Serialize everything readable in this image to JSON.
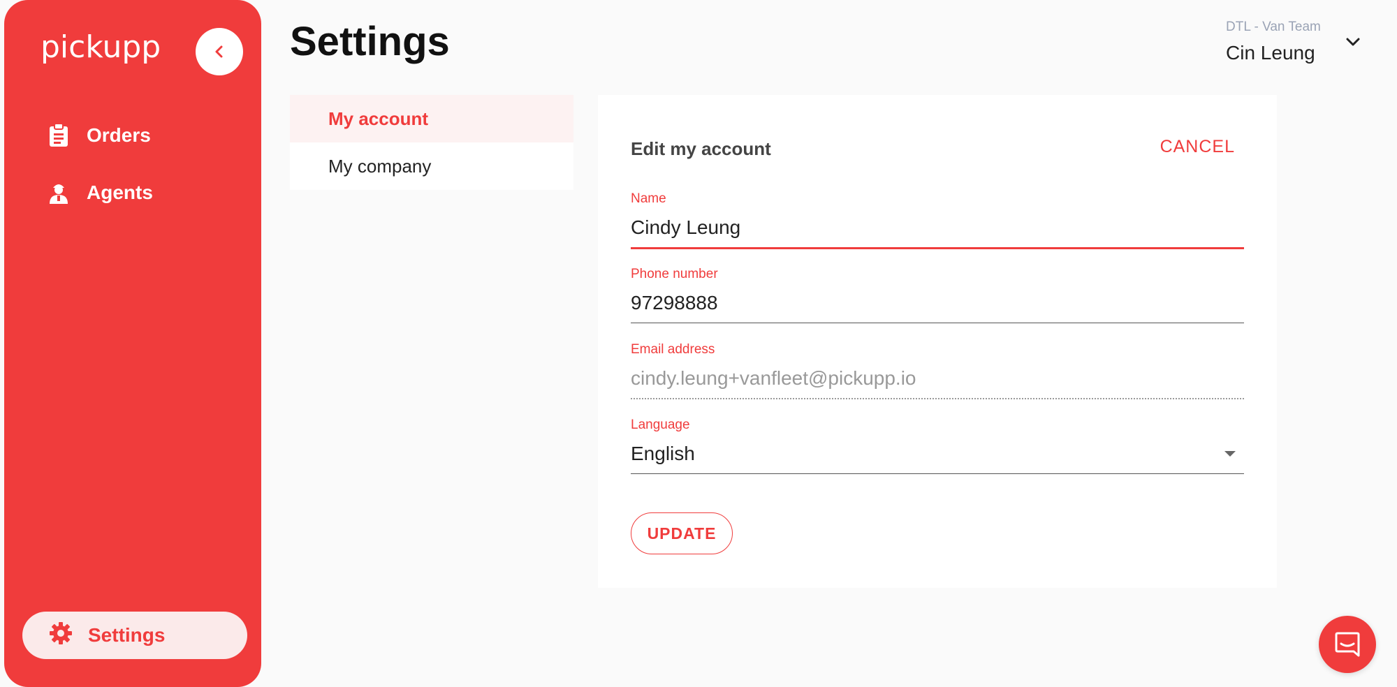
{
  "app": {
    "logo_text": "pickupp",
    "brand_color": "#f03c3c"
  },
  "sidebar": {
    "items": [
      {
        "label": "Orders",
        "icon": "clipboard-icon"
      },
      {
        "label": "Agents",
        "icon": "agent-icon"
      }
    ],
    "settings": {
      "label": "Settings",
      "icon": "gear-icon",
      "active": true
    }
  },
  "header": {
    "title": "Settings",
    "team": "DTL - Van Team",
    "user": "Cin Leung"
  },
  "submenu": {
    "items": [
      {
        "label": "My account",
        "active": true
      },
      {
        "label": "My company",
        "active": false
      }
    ]
  },
  "form": {
    "title": "Edit my account",
    "cancel_label": "CANCEL",
    "name": {
      "label": "Name",
      "value": "Cindy Leung"
    },
    "phone": {
      "label": "Phone number",
      "value": "97298888"
    },
    "email": {
      "label": "Email address",
      "value": "cindy.leung+vanfleet@pickupp.io"
    },
    "language": {
      "label": "Language",
      "value": "English"
    },
    "update_label": "UPDATE"
  },
  "chat": {
    "icon": "chat-icon"
  }
}
